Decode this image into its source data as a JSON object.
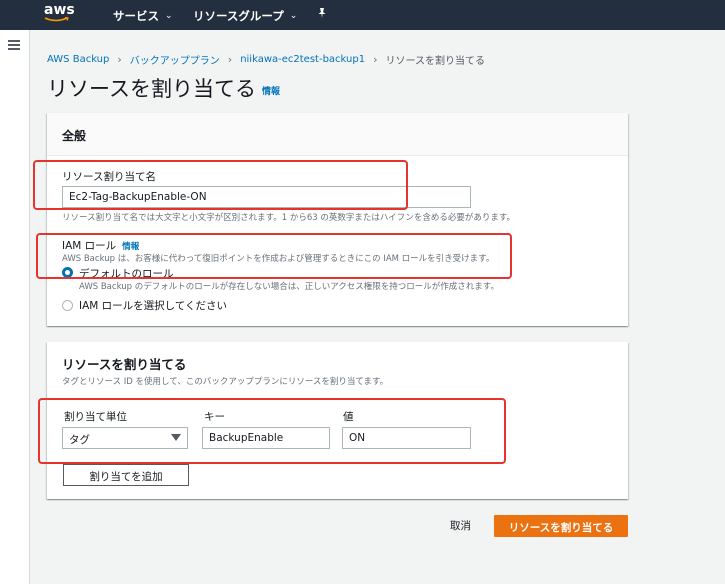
{
  "nav": {
    "logo": "aws",
    "services": "サービス",
    "resource_groups": "リソースグループ"
  },
  "breadcrumb": {
    "items": [
      "AWS Backup",
      "バックアッププラン",
      "niikawa-ec2test-backup1",
      "リソースを割り当てる"
    ]
  },
  "page": {
    "title": "リソースを割り当てる",
    "info": "情報"
  },
  "general": {
    "title": "全般",
    "name_label": "リソース割り当て名",
    "name_value": "Ec2-Tag-BackupEnable-ON",
    "name_help": "リソース割り当て名では大文字と小文字が区別されます。1 から63 の英数字またはハイフンを含める必要があります。",
    "iam_label": "IAM ロール",
    "iam_info": "情報",
    "iam_help": "AWS Backup は、お客様に代わって復旧ポイントを作成および管理するときにこの IAM ロールを引き受けます。",
    "default_role_label": "デフォルトのロール",
    "default_role_help": "AWS Backup のデフォルトのロールが存在しない場合は、正しいアクセス権限を持つロールが作成されます。",
    "select_role_label": "IAM ロールを選択してください"
  },
  "assign": {
    "title": "リソースを割り当てる",
    "subtitle": "タグとリソース ID を使用して、このバックアッププランにリソースを割り当てます。",
    "unit_label": "割り当て単位",
    "key_label": "キー",
    "value_label": "値",
    "unit_value": "タグ",
    "key_value": "BackupEnable",
    "value_value": "ON",
    "add_button": "割り当てを追加"
  },
  "footer": {
    "cancel": "取消",
    "submit": "リソースを割り当てる"
  },
  "colors": {
    "nav_bg": "#232f3e",
    "primary": "#ec7211",
    "link": "#0073bb",
    "highlight": "#e5342f"
  }
}
